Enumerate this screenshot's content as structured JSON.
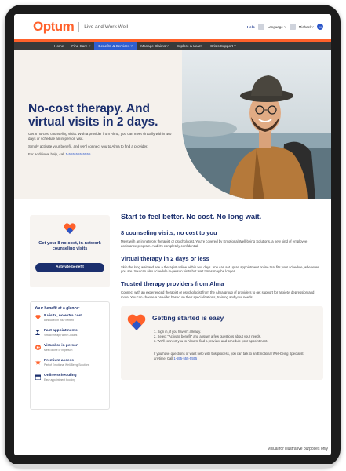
{
  "header": {
    "logo": "Optum",
    "tagline": "Live and Work Well",
    "help": "Help",
    "language": "Language ˅",
    "user": "Michael ˅",
    "user_initial": "M"
  },
  "nav": {
    "items": [
      {
        "label": "Home"
      },
      {
        "label": "Find Care ˅"
      },
      {
        "label": "Benefits & Services ˅"
      },
      {
        "label": "Manage Claims ˅"
      },
      {
        "label": "Explore & Learn"
      },
      {
        "label": "Crisis Support ˅"
      }
    ],
    "active_index": 2
  },
  "hero": {
    "title": "No-cost therapy. And virtual visits in 2 days.",
    "p1": "Get 8 no-cost counseling visits. With a provider from Alma, you can meet virtually within two days or schedule an in-person visit.",
    "p2": "Simply activate your benefit, and we'll connect you to Alma to find a provider.",
    "p3_prefix": "For additional help, call ",
    "phone": "1-555-555-5555"
  },
  "sidebar": {
    "card_title": "Get your 8 no-cost, in-network counseling visits",
    "activate_button": "Activate benefit",
    "glance_title": "Your benefit at a glance:",
    "glance_items": [
      {
        "title": "8 visits, no extra cost",
        "desc": "8 included in your benefit",
        "icon": "heart-icon"
      },
      {
        "title": "Fast appointments",
        "desc": "Virtual therapy within 2 days",
        "icon": "hourglass-icon"
      },
      {
        "title": "Virtual or in person",
        "desc": "Meet online or in person",
        "icon": "video-icon"
      },
      {
        "title": "Premium access",
        "desc": "Part of Emotional Well-Being Solutions",
        "icon": "star-icon"
      },
      {
        "title": "Online scheduling",
        "desc": "Easy appointment booking",
        "icon": "calendar-icon"
      }
    ]
  },
  "main": {
    "title": "Start to feel better. No cost. No long wait.",
    "sections": [
      {
        "heading": "8 counseling visits, no cost to you",
        "body": "Meet with an in-network therapist or psychologist. You're covered by Emotional Well-being Solutions, a new kind of employee assistance program. And it's completely confidential."
      },
      {
        "heading": "Virtual therapy in 2 days or less",
        "body": "Skip the long wait and see a therapist online within two days. You can set up an appointment online that fits your schedule, whenever you are. You can also schedule in-person visits but wait times may be longer."
      },
      {
        "heading": "Trusted therapy providers from Alma",
        "body": "Connect with an experienced therapist or psychologist from the Alma group of providers to get support for anxiety, depression and more. You can choose a provider based on their specializations, training and your needs."
      }
    ],
    "easy": {
      "title": "Getting started is easy",
      "steps": [
        "1. Sign in, if you haven't already.",
        "2. Select \"Activate benefit\" and answer a few questions about your needs.",
        "3. We'll connect you to Alma to find a provider and schedule your appointment."
      ],
      "note_prefix": "If you have questions or want help with this process, you can talk to an Emotional Well-being Specialist anytime. Call ",
      "phone": "1-555-555-5555"
    }
  },
  "footer": {
    "disclaimer": "Visual for illustrative purposes only"
  },
  "colors": {
    "brand_orange": "#ff612b",
    "navy": "#1b2f6e",
    "nav_bg": "#3a3a3a",
    "active_nav": "#2f5fd0",
    "card_bg": "#f7f4f1"
  }
}
